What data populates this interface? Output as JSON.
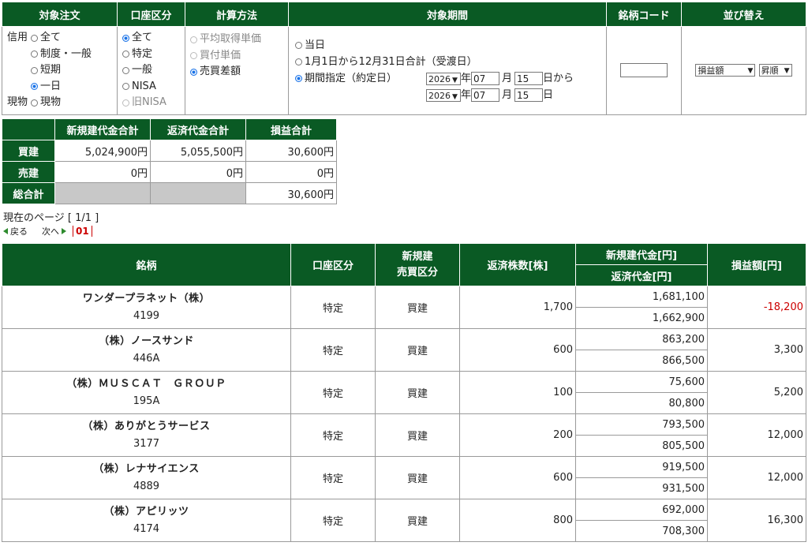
{
  "filter": {
    "headers": [
      "対象注文",
      "口座区分",
      "計算方法",
      "対象期間",
      "銘柄コード",
      "並び替え"
    ],
    "order": {
      "group1_label": "信用",
      "group1": [
        {
          "label": "全て",
          "checked": false
        },
        {
          "label": "制度・一般",
          "checked": false
        },
        {
          "label": "短期",
          "checked": false
        },
        {
          "label": "一日",
          "checked": true
        }
      ],
      "group2_label": "現物",
      "group2": [
        {
          "label": "現物",
          "checked": false
        }
      ]
    },
    "account": [
      {
        "label": "全て",
        "checked": true,
        "disabled": false
      },
      {
        "label": "特定",
        "checked": false,
        "disabled": false
      },
      {
        "label": "一般",
        "checked": false,
        "disabled": false
      },
      {
        "label": "NISA",
        "checked": false,
        "disabled": false
      },
      {
        "label": "旧NISA",
        "checked": false,
        "disabled": true
      }
    ],
    "calc": [
      {
        "label": "平均取得単価",
        "checked": false,
        "disabled": true
      },
      {
        "label": "買付単価",
        "checked": false,
        "disabled": true
      },
      {
        "label": "売買差額",
        "checked": true,
        "disabled": false
      }
    ],
    "period": {
      "opt1": "当日",
      "opt2": "1月1日から12月31日合計（受渡日）",
      "opt3": "期間指定（約定日）",
      "from": {
        "year": "2026",
        "month": "07",
        "day": "15",
        "suffix": "日から"
      },
      "to": {
        "year": "2026",
        "month": "07",
        "day": "15",
        "suffix": "日"
      },
      "year_unit": "年",
      "month_unit": "月"
    },
    "code_value": "",
    "sort": {
      "key": "損益額",
      "order": "昇順"
    }
  },
  "summary": {
    "headers": [
      "新規建代金合計",
      "返済代金合計",
      "損益合計"
    ],
    "rows": [
      {
        "label": "買建",
        "new": "5,024,900円",
        "repay": "5,055,500円",
        "pl": "30,600円"
      },
      {
        "label": "売建",
        "new": "0円",
        "repay": "0円",
        "pl": "0円"
      },
      {
        "label": "総合計",
        "new": "",
        "repay": "",
        "pl": "30,600円"
      }
    ]
  },
  "paging": {
    "current": "現在のページ [ 1/1 ]",
    "back": "戻る",
    "next": "次へ",
    "page": "01"
  },
  "list": {
    "headers": {
      "name": "銘柄",
      "account": "口座区分",
      "side_line1": "新規建",
      "side_line2": "売買区分",
      "qty": "返済株数[株]",
      "new_amt": "新規建代金[円]",
      "repay_amt": "返済代金[円]",
      "pl": "損益額[円]"
    },
    "rows": [
      {
        "name": "ワンダープラネット（株）",
        "code": "4199",
        "account": "特定",
        "side": "買建",
        "qty": "1,700",
        "new": "1,681,100",
        "repay": "1,662,900",
        "pl": "-18,200"
      },
      {
        "name": "（株）ノースサンド",
        "code": "446A",
        "account": "特定",
        "side": "買建",
        "qty": "600",
        "new": "863,200",
        "repay": "866,500",
        "pl": "3,300"
      },
      {
        "name": "（株）ＭＵＳＣＡＴ　ＧＲＯＵＰ",
        "code": "195A",
        "account": "特定",
        "side": "買建",
        "qty": "100",
        "new": "75,600",
        "repay": "80,800",
        "pl": "5,200"
      },
      {
        "name": "（株）ありがとうサービス",
        "code": "3177",
        "account": "特定",
        "side": "買建",
        "qty": "200",
        "new": "793,500",
        "repay": "805,500",
        "pl": "12,000"
      },
      {
        "name": "（株）レナサイエンス",
        "code": "4889",
        "account": "特定",
        "side": "買建",
        "qty": "600",
        "new": "919,500",
        "repay": "931,500",
        "pl": "12,000"
      },
      {
        "name": "（株）アピリッツ",
        "code": "4174",
        "account": "特定",
        "side": "買建",
        "qty": "800",
        "new": "692,000",
        "repay": "708,300",
        "pl": "16,300"
      }
    ]
  }
}
